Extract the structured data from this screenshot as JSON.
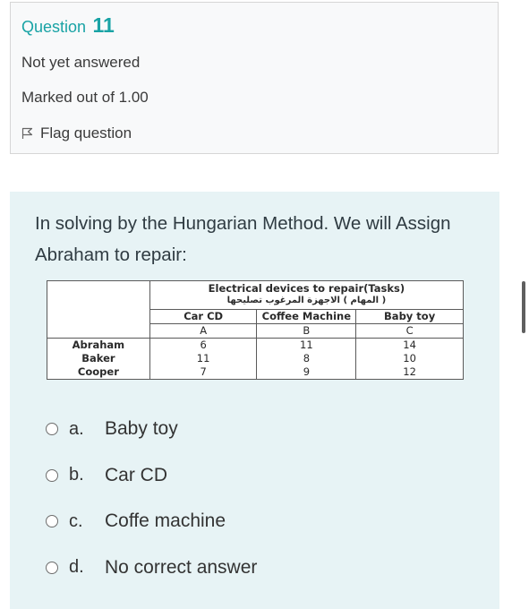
{
  "info": {
    "question_word": "Question",
    "question_number": "11",
    "status": "Not yet answered",
    "marks": "Marked out of 1.00",
    "flag_label": "Flag question"
  },
  "question": {
    "text": "In solving by the Hungarian Method. We will Assign Abraham to repair:"
  },
  "table": {
    "header_line1": "Electrical devices to repair(Tasks)",
    "header_line2": "( المهام  ) الاجهزة المرغوب تصليحها",
    "columns": [
      {
        "name": "Car CD",
        "letter": "A"
      },
      {
        "name": "Coffee Machine",
        "letter": "B"
      },
      {
        "name": "Baby toy",
        "letter": "C"
      }
    ],
    "rows": [
      {
        "name": "Abraham",
        "values": [
          "6",
          "11",
          "14"
        ]
      },
      {
        "name": "Baker",
        "values": [
          "11",
          "8",
          "10"
        ]
      },
      {
        "name": "Cooper",
        "values": [
          "7",
          "9",
          "12"
        ]
      }
    ]
  },
  "options": [
    {
      "letter": "a.",
      "text": "Baby toy"
    },
    {
      "letter": "b.",
      "text": "Car CD"
    },
    {
      "letter": "c.",
      "text": "Coffe machine"
    },
    {
      "letter": "d.",
      "text": "No correct answer"
    }
  ],
  "colors": {
    "accent": "#19a3a5",
    "content_bg": "#e7f3f5",
    "info_bg": "#f8f9fa"
  }
}
